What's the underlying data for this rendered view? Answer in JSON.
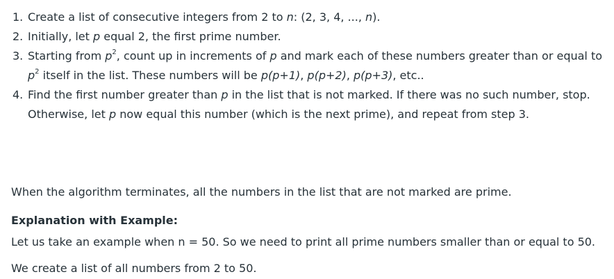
{
  "steps": [
    {
      "num": "1.",
      "parts": [
        "Create a list of consecutive integers from 2 to ",
        "n",
        ": (2, 3, 4, ..., ",
        "n",
        ")."
      ]
    },
    {
      "num": "2.",
      "parts": [
        "Initially, let ",
        "p",
        " equal 2, the first prime number."
      ]
    },
    {
      "num": "3.",
      "parts": [
        "Starting from ",
        "p",
        "2",
        ", count up in increments of ",
        "p",
        " and mark each of these numbers greater than or equal to ",
        "p",
        "2",
        " itself in the list. These numbers will be ",
        "p(p+1)",
        ", ",
        "p(p+2)",
        ", ",
        "p(p+3)",
        ", etc.."
      ]
    },
    {
      "num": "4.",
      "parts": [
        "Find the first number greater than ",
        "p",
        " in the list that is not marked. If there was no such number, stop. Otherwise, let ",
        "p",
        " now equal this number (which is the next prime), and repeat from step 3."
      ]
    }
  ],
  "paragraphs": {
    "terminate": "When the algorithm terminates, all the numbers in the list that are not marked are prime.",
    "heading": "Explanation with Example:",
    "example": "Let us take an example when n = 50. So we need to print all prime numbers smaller than or equal to 50.",
    "create": "We create a list of all numbers from 2 to 50."
  }
}
